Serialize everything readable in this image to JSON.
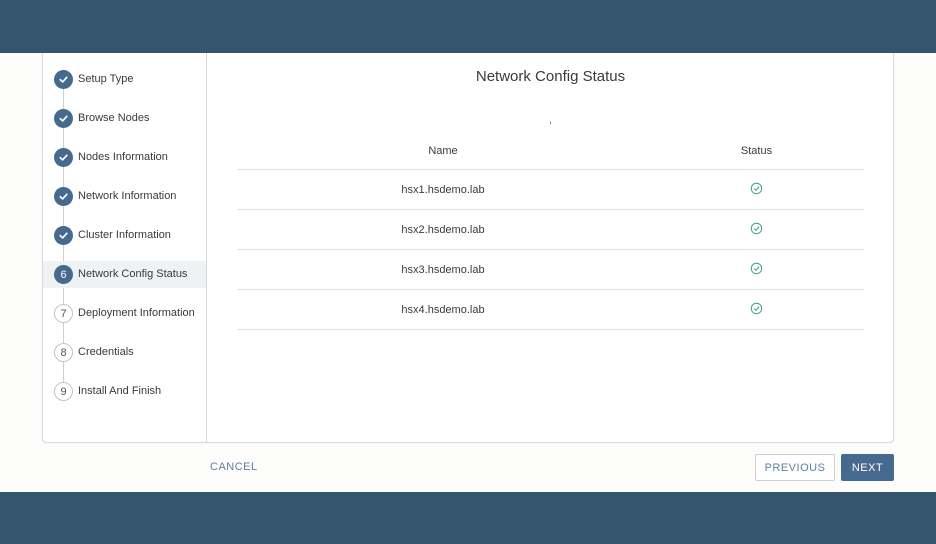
{
  "wizard": {
    "steps": [
      {
        "label": "Setup Type",
        "state": "done",
        "number": "1"
      },
      {
        "label": "Browse Nodes",
        "state": "done",
        "number": "2"
      },
      {
        "label": "Nodes Information",
        "state": "done",
        "number": "3"
      },
      {
        "label": "Network Information",
        "state": "done",
        "number": "4"
      },
      {
        "label": "Cluster Information",
        "state": "done",
        "number": "5"
      },
      {
        "label": "Network Config Status",
        "state": "current",
        "number": "6"
      },
      {
        "label": "Deployment Information",
        "state": "pending",
        "number": "7"
      },
      {
        "label": "Credentials",
        "state": "pending",
        "number": "8"
      },
      {
        "label": "Install And Finish",
        "state": "pending",
        "number": "9"
      }
    ]
  },
  "main": {
    "title": "Network Config Status",
    "note": ",",
    "table": {
      "headers": {
        "name": "Name",
        "status": "Status"
      },
      "rows": [
        {
          "name": "hsx1.hsdemo.lab",
          "status": "success-check-icon"
        },
        {
          "name": "hsx2.hsdemo.lab",
          "status": "success-check-icon"
        },
        {
          "name": "hsx3.hsdemo.lab",
          "status": "success-check-icon"
        },
        {
          "name": "hsx4.hsdemo.lab",
          "status": "success-check-icon"
        }
      ]
    }
  },
  "footer": {
    "cancel_label": "CANCEL",
    "previous_label": "PREVIOUS",
    "next_label": "NEXT"
  },
  "colors": {
    "header_bar": "#35556f",
    "accent": "#46698e",
    "success": "#3ca27c"
  }
}
